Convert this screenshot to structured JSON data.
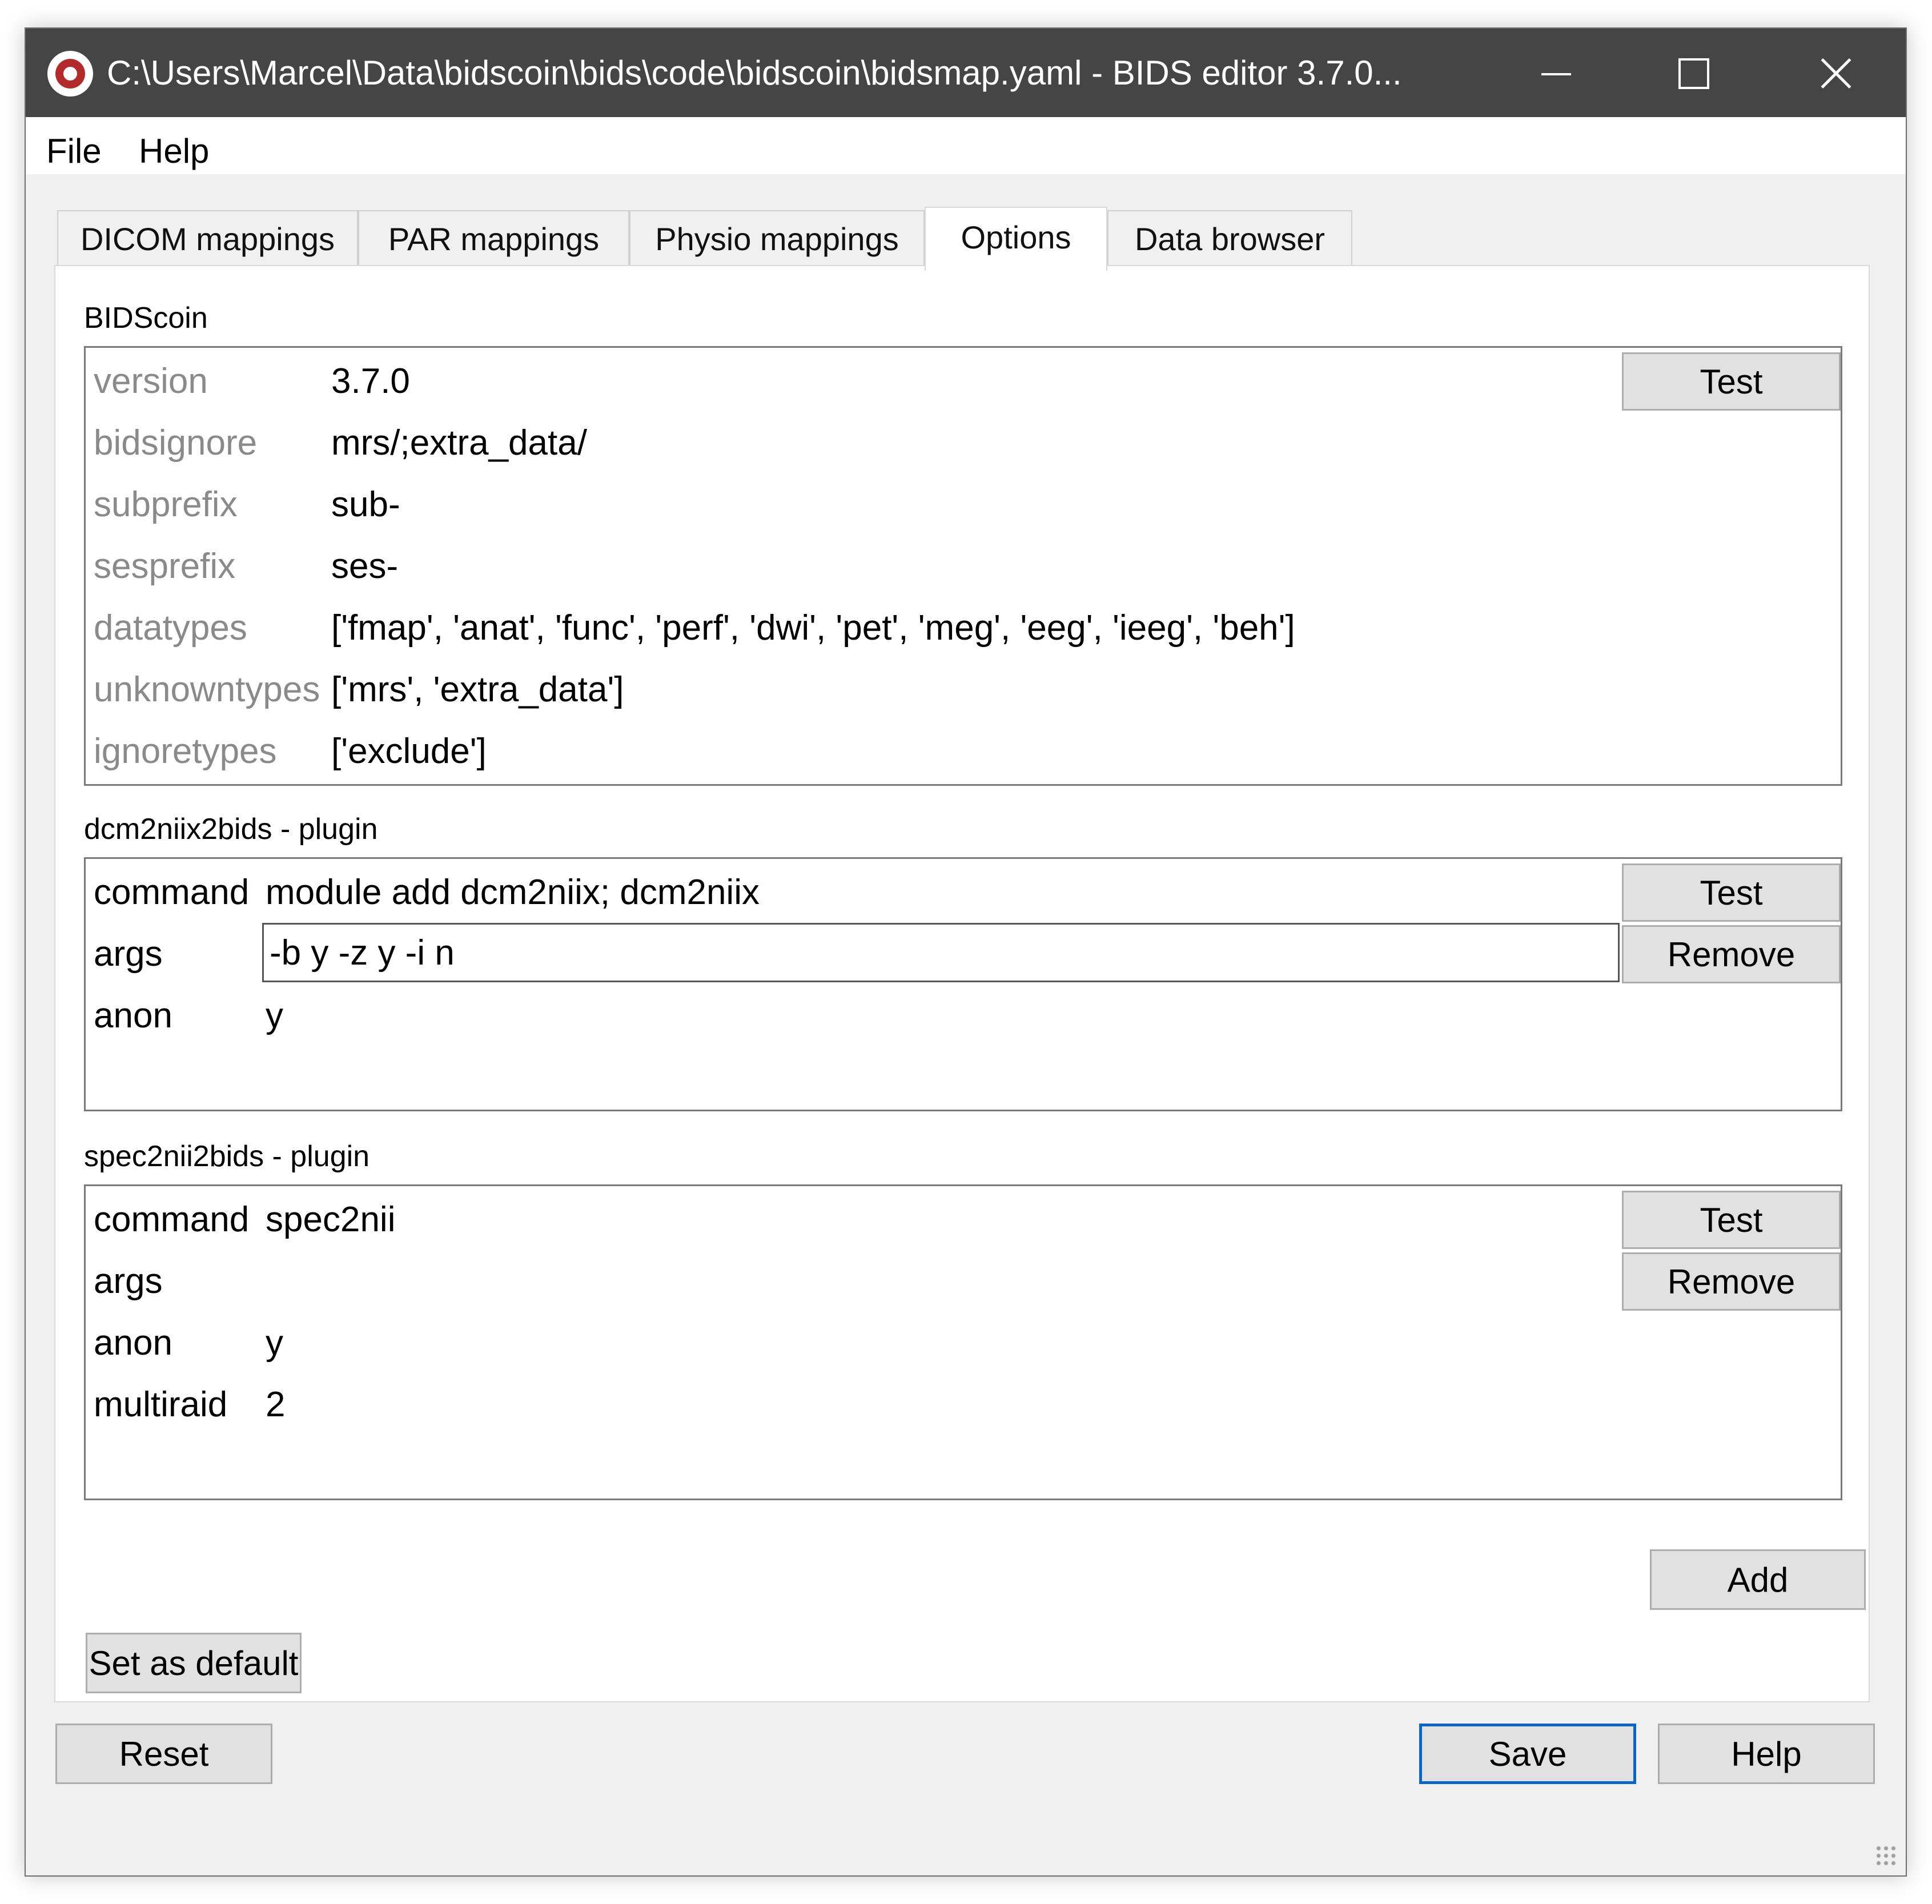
{
  "window": {
    "title": "C:\\Users\\Marcel\\Data\\bidscoin\\bids\\code\\bidscoin\\bidsmap.yaml - BIDS editor 3.7.0...",
    "icon": "bidscoin-logo-icon",
    "controls": [
      "minimize-icon",
      "maximize-icon",
      "close-icon"
    ]
  },
  "menu": {
    "file": "File",
    "help": "Help"
  },
  "tabs": [
    {
      "label": "DICOM mappings",
      "active": false
    },
    {
      "label": "PAR mappings",
      "active": false
    },
    {
      "label": "Physio mappings",
      "active": false
    },
    {
      "label": "Options",
      "active": true
    },
    {
      "label": "Data browser",
      "active": false
    }
  ],
  "bidscoin": {
    "heading": "BIDScoin",
    "test_label": "Test",
    "rows": [
      {
        "key": "version",
        "value": "3.7.0"
      },
      {
        "key": "bidsignore",
        "value": "mrs/;extra_data/"
      },
      {
        "key": "subprefix",
        "value": "sub-"
      },
      {
        "key": "sesprefix",
        "value": "ses-"
      },
      {
        "key": "datatypes",
        "value": "['fmap', 'anat', 'func', 'perf', 'dwi', 'pet', 'meg', 'eeg', 'ieeg', 'beh']"
      },
      {
        "key": "unknowntypes",
        "value": "['mrs', 'extra_data']"
      },
      {
        "key": "ignoretypes",
        "value": "['exclude']"
      }
    ]
  },
  "dcm2niix": {
    "heading": "dcm2niix2bids - plugin",
    "test_label": "Test",
    "remove_label": "Remove",
    "rows": [
      {
        "key": "command",
        "value": "module add dcm2niix; dcm2niix"
      },
      {
        "key": "args",
        "value": "-b y -z y -i n"
      },
      {
        "key": "anon",
        "value": "y"
      }
    ]
  },
  "spec2nii": {
    "heading": "spec2nii2bids - plugin",
    "test_label": "Test",
    "remove_label": "Remove",
    "rows": [
      {
        "key": "command",
        "value": "spec2nii"
      },
      {
        "key": "args",
        "value": ""
      },
      {
        "key": "anon",
        "value": "y"
      },
      {
        "key": "multiraid",
        "value": "2"
      }
    ]
  },
  "buttons": {
    "add": "Add",
    "set_default": "Set as default",
    "reset": "Reset",
    "save": "Save",
    "help": "Help"
  },
  "colors": {
    "titlebar": "#454545",
    "key_grey": "#8a8a8a",
    "focus_blue": "#0a64c8",
    "button_face": "#e1e1e1"
  }
}
